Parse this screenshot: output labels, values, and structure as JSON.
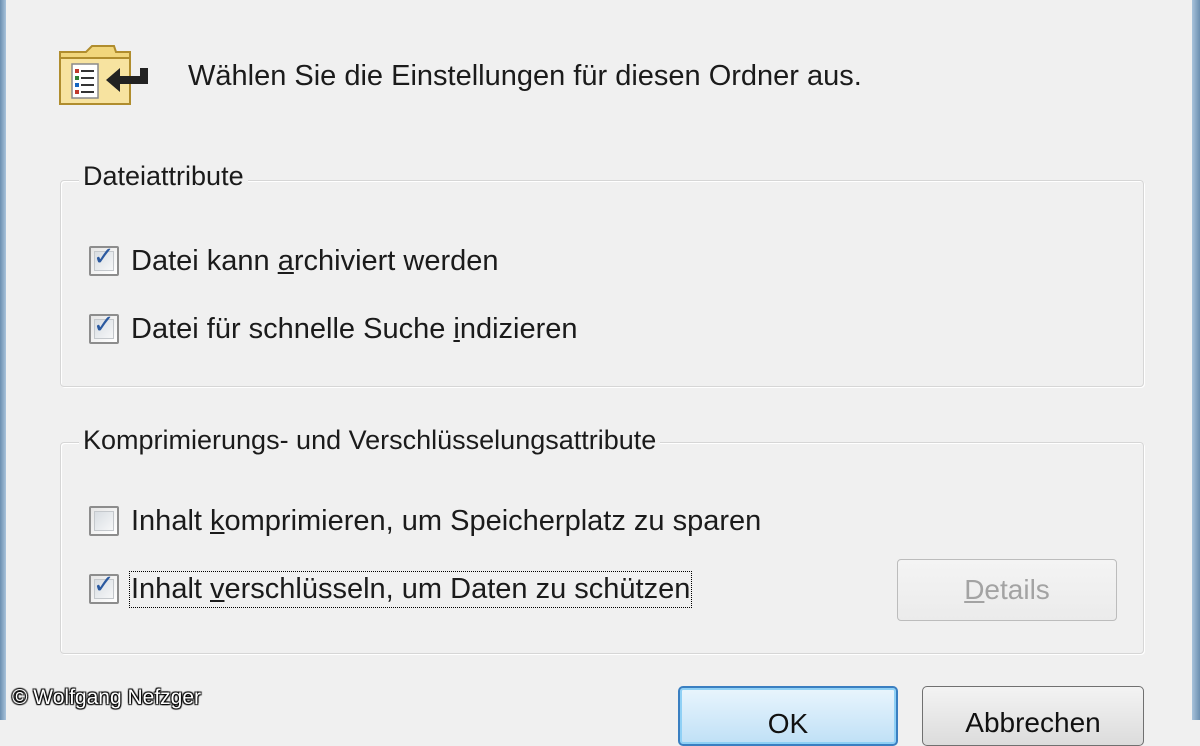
{
  "header": {
    "icon": "folder-settings-icon",
    "text": "Wählen Sie die Einstellungen für diesen Ordner aus."
  },
  "file_attributes": {
    "legend": "Dateiattribute",
    "archive": {
      "label_pre": "Datei kann ",
      "label_key": "a",
      "label_post": "rchiviert werden",
      "checked": true
    },
    "index": {
      "label_pre": "Datei für schnelle Suche ",
      "label_key": "i",
      "label_post": "ndizieren",
      "checked": true
    }
  },
  "compression_encryption": {
    "legend": "Komprimierungs- und Verschlüsselungsattribute",
    "compress": {
      "label_pre": "Inhalt ",
      "label_key": "k",
      "label_post": "omprimieren, um Speicherplatz zu sparen",
      "checked": false
    },
    "encrypt": {
      "label_pre": "Inhalt ",
      "label_key": "v",
      "label_post": "erschlüsseln, um Daten zu schützen",
      "checked": true
    },
    "details_button": {
      "label_key": "D",
      "label_post": "etails",
      "enabled": false
    }
  },
  "buttons": {
    "ok_label": "OK",
    "cancel_pre": "Abbrechen"
  },
  "copyright": "© Wolfgang Nefzger",
  "colors": {
    "dialog_bg": "#f0f0f0",
    "check_mark": "#2c5aa0",
    "ok_border": "#3a7fc1",
    "disabled_text": "#a3a3a3"
  }
}
